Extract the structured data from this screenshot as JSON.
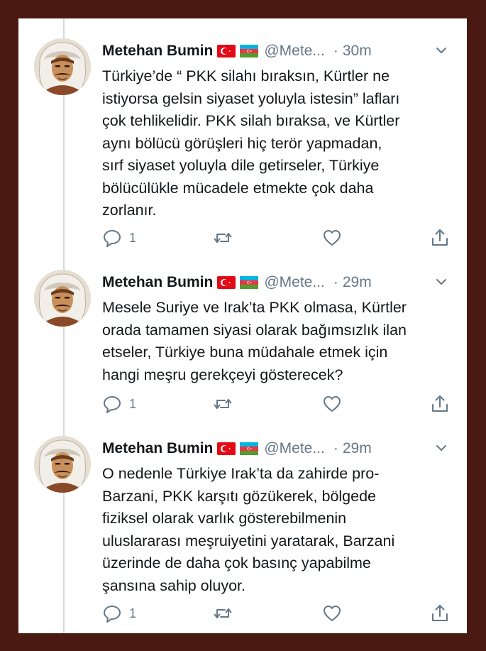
{
  "colors": {
    "frame": "#4a1a12",
    "text": "#14171a",
    "muted": "#657786",
    "thread_line": "#d4d9dd"
  },
  "tweets": [
    {
      "name": "Metehan Bumin",
      "flags": [
        "turkey-flag",
        "azerbaijan-flag"
      ],
      "handle": "@Mete...",
      "separator": "·",
      "time": "30m",
      "lines": [
        "Türkiye’de “ PKK silahı bıraksın, Kürtler ne",
        "istiyorsa gelsin siyaset yoluyla istesin” lafları",
        "çok tehlikelidir. PKK silah bıraksa, ve Kürtler",
        "aynı bölücü görüşleri hiç terör yapmadan,",
        "sırf siyaset yoluyla dile getirseler, Türkiye",
        "bölücülükle mücadele etmekte çok daha",
        "zorlanır."
      ],
      "reply_count": "1"
    },
    {
      "name": "Metehan Bumin",
      "flags": [
        "turkey-flag",
        "azerbaijan-flag"
      ],
      "handle": "@Mete...",
      "separator": "·",
      "time": "29m",
      "lines": [
        "Mesele Suriye ve Irak’ta PKK olmasa, Kürtler",
        "orada tamamen siyasi olarak bağımsızlık ilan",
        "etseler, Türkiye buna müdahale etmek için",
        "hangi meşru gerekçeyi gösterecek?"
      ],
      "reply_count": "1"
    },
    {
      "name": "Metehan Bumin",
      "flags": [
        "turkey-flag",
        "azerbaijan-flag"
      ],
      "handle": "@Mete...",
      "separator": "·",
      "time": "29m",
      "lines": [
        "O nedenle Türkiye Irak’ta da zahirde pro-",
        "Barzani, PKK karşıtı gözükerek, bölgede",
        "fiziksel olarak varlık gösterebilmenin",
        "uluslararası meşruiyetini yaratarak, Barzani",
        "üzerinde de daha çok basınç yapabilme",
        "şansına sahip oluyor."
      ],
      "reply_count": "1"
    }
  ]
}
